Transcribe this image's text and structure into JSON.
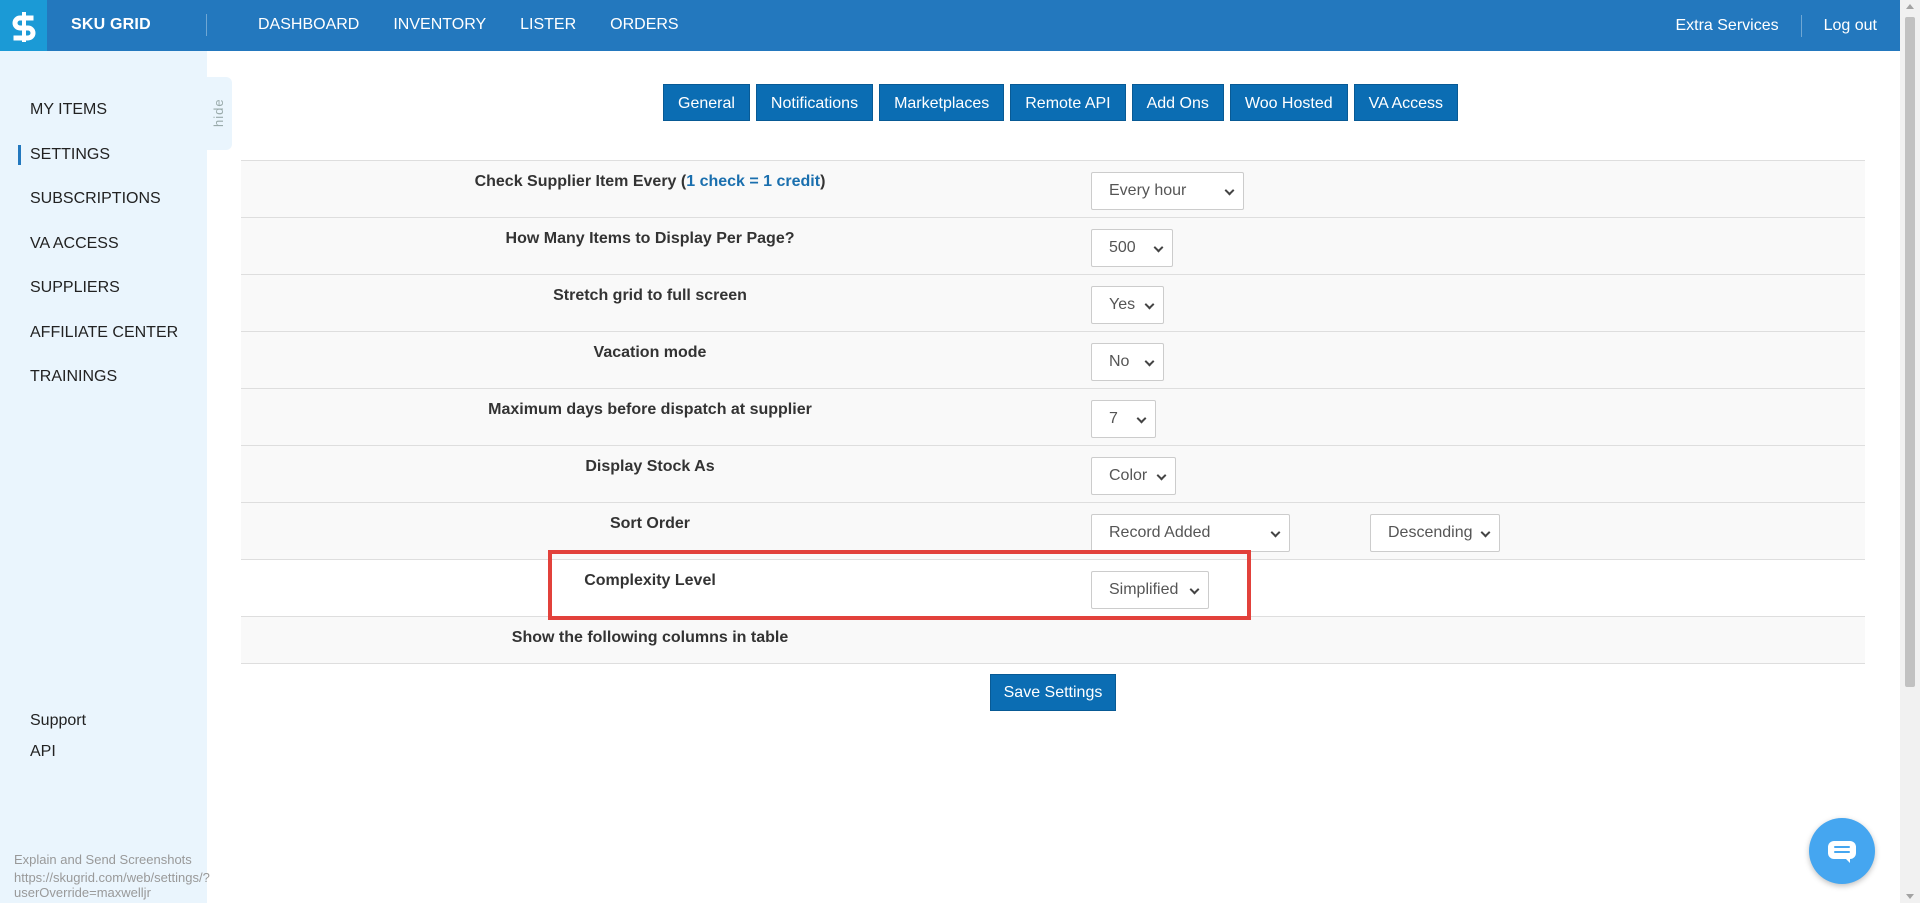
{
  "brand": "SKU GRID",
  "nav": [
    "DASHBOARD",
    "INVENTORY",
    "LISTER",
    "ORDERS"
  ],
  "top_right": {
    "extra": "Extra Services",
    "logout": "Log out"
  },
  "sidebar": {
    "items": [
      "MY ITEMS",
      "SETTINGS",
      "SUBSCRIPTIONS",
      "VA ACCESS",
      "SUPPLIERS",
      "AFFILIATE CENTER",
      "TRAININGS"
    ],
    "active": "SETTINGS",
    "bottom": [
      "Support",
      "API"
    ],
    "hide_label": "hide"
  },
  "tabs": [
    "General",
    "Notifications",
    "Marketplaces",
    "Remote API",
    "Add Ons",
    "Woo Hosted",
    "VA Access"
  ],
  "settings": {
    "check_supplier": {
      "prefix": "Check Supplier Item Every (",
      "link": "1 check = 1 credit",
      "suffix": ")",
      "value": "Every hour"
    },
    "items_per_page": {
      "label": "How Many Items to Display Per Page?",
      "value": "500"
    },
    "stretch_grid": {
      "label": "Stretch grid to full screen",
      "value": "Yes"
    },
    "vacation_mode": {
      "label": "Vacation mode",
      "value": "No"
    },
    "max_days": {
      "label": "Maximum days before dispatch at supplier",
      "value": "7"
    },
    "display_stock": {
      "label": "Display Stock As",
      "value": "Color"
    },
    "sort_order": {
      "label": "Sort Order",
      "value": "Record Added",
      "direction": "Descending"
    },
    "complexity": {
      "label": "Complexity Level",
      "value": "Simplified"
    },
    "show_columns": "Show the following columns in table"
  },
  "save_label": "Save Settings",
  "footer": {
    "line1": "Explain and Send Screenshots",
    "line2": "https://skugrid.com/web/settings/?userOverride=maxwelljr"
  },
  "colors": {
    "topbar": "#2378be",
    "button": "#0b6db3",
    "sidebar": "#eaf5fd",
    "highlight": "#e2413b"
  }
}
